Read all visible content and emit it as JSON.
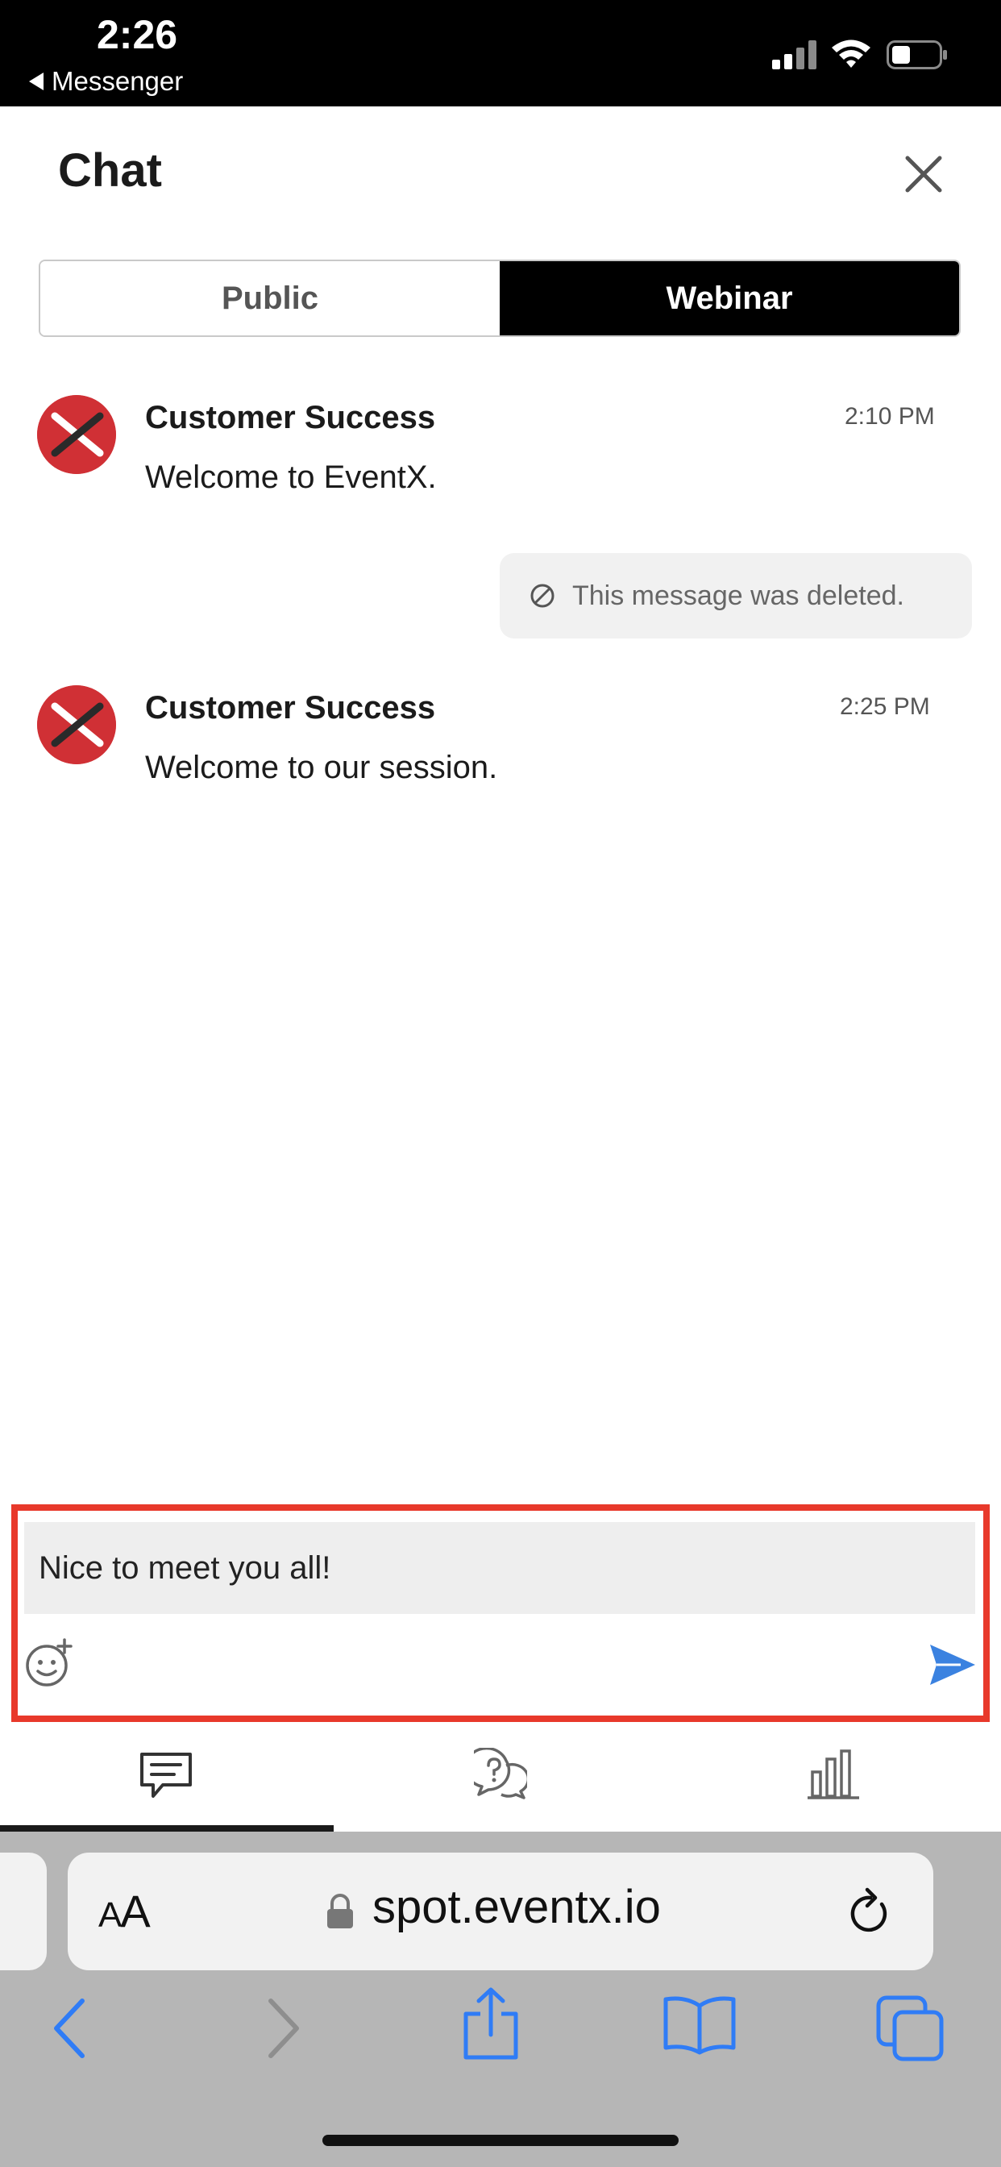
{
  "status_bar": {
    "time": "2:26",
    "back_app": "Messenger"
  },
  "header": {
    "title": "Chat"
  },
  "tabs": [
    {
      "label": "Public",
      "active": false
    },
    {
      "label": "Webinar",
      "active": true
    }
  ],
  "messages": [
    {
      "sender": "Customer Success",
      "text": "Welcome to EventX.",
      "time": "2:10 PM"
    },
    {
      "deleted_text": "This message was deleted."
    },
    {
      "sender": "Customer Success",
      "text": "Welcome to our session.",
      "time": "2:25 PM"
    }
  ],
  "composer": {
    "value": "Nice to meet you all!"
  },
  "browser": {
    "aa_label_big": "A",
    "aa_label_small": "A",
    "url": "spot.eventx.io"
  },
  "colors": {
    "accent_send": "#3b82e0",
    "avatar_red": "#d03035",
    "highlight_border": "#e8392b",
    "safari_blue": "#2f7cf6"
  },
  "icons": {
    "emoji": "emoji-add-icon",
    "send": "send-icon",
    "chat": "chat-icon",
    "qa": "question-bubbles-icon",
    "poll": "poll-chart-icon"
  }
}
